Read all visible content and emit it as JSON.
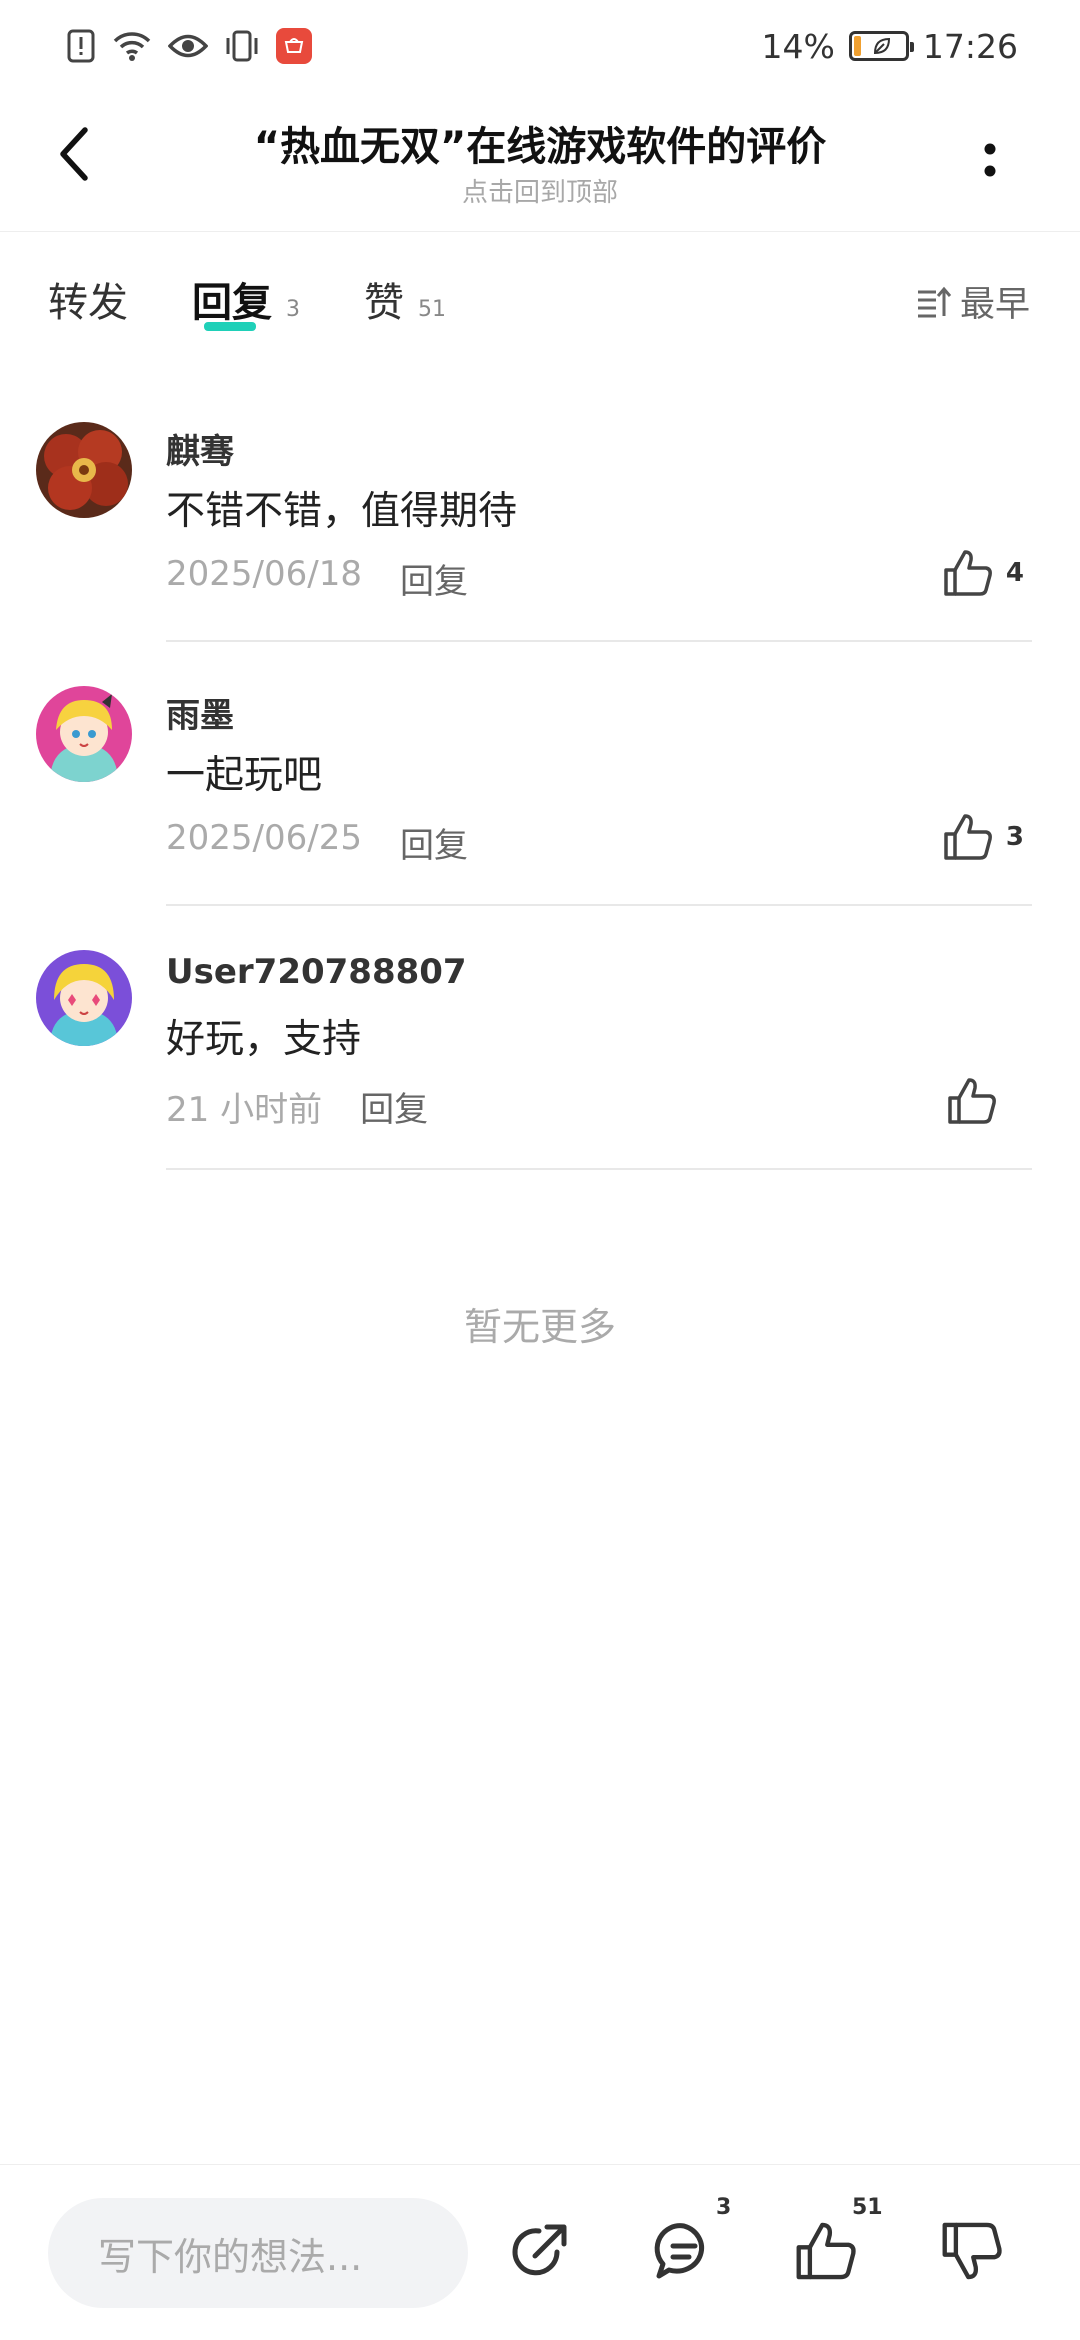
{
  "status_bar": {
    "battery": "14%",
    "time": "17:26",
    "battery_level": 0.14,
    "icons": [
      "alert-icon",
      "wifi-icon",
      "eye-icon",
      "vibrate-icon",
      "huawei-app-icon"
    ]
  },
  "header": {
    "title": "“热血无双”在线游戏软件的评价",
    "subtitle": "点击回到顶部"
  },
  "tabs": [
    {
      "label": "转发",
      "count": ""
    },
    {
      "label": "回复",
      "count": "3"
    },
    {
      "label": "赞",
      "count": "51"
    }
  ],
  "sort_label": "最早",
  "comments": [
    {
      "name": "麒骞",
      "text": "不错不错，值得期待",
      "date": "2025/06/18",
      "reply": "回复",
      "likes": "4"
    },
    {
      "name": "雨墨",
      "text": "一起玩吧",
      "date": "2025/06/25",
      "reply": "回复",
      "likes": "3"
    },
    {
      "name": "User720788807",
      "text": "好玩，支持",
      "date": "21 小时前",
      "reply": "回复",
      "likes": ""
    }
  ],
  "no_more": "暂无更多",
  "bottom_bar": {
    "input_placeholder": "写下你的想法...",
    "comment_count": "3",
    "like_count": "51"
  },
  "colors": {
    "accent": "#1fd0b8",
    "battery": "#f0a030"
  }
}
